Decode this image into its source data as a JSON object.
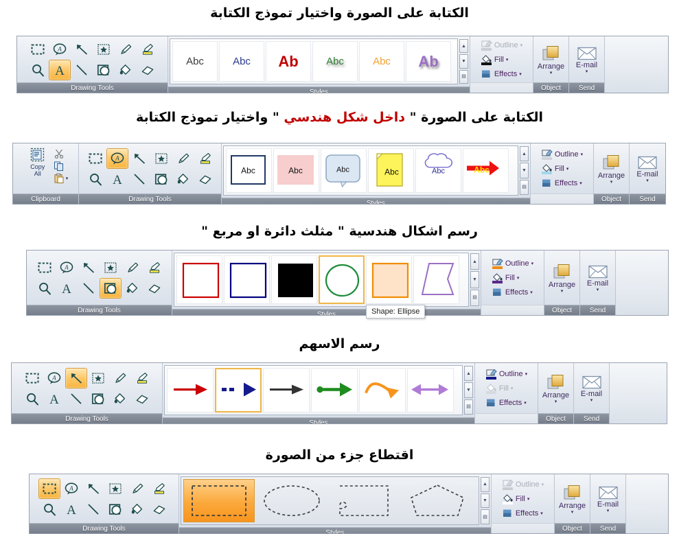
{
  "headings": [
    {
      "id": "h1",
      "text": "الكتابة على الصورة واختيار تموذج الكتابة"
    },
    {
      "id": "h2a",
      "text": "الكتابة على الصورة \" ",
      "red": "داخل شكل هندسي",
      "after": " \" واختيار تموذج الكتابة"
    },
    {
      "id": "h3",
      "text": "رسم اشكال هندسية \" مثلث دائرة او مربع \""
    },
    {
      "id": "h4",
      "text": "رسم الاسهم"
    },
    {
      "id": "h5",
      "text": "اقتطاع جزء من الصورة"
    }
  ],
  "group_labels": {
    "drawing_tools": "Drawing Tools",
    "styles": "Styles",
    "object": "Object",
    "send": "Send",
    "clipboard": "Clipboard"
  },
  "clipboard": {
    "copy_all_line1": "Copy",
    "copy_all_line2": "All",
    "cut_icon": "scissors-icon",
    "copy_icon": "copy-icon",
    "paste_icon": "paste-icon",
    "paste_caret": "▾"
  },
  "tool_names": [
    "select-rectangle-tool",
    "callout-text-tool",
    "arrow-line-tool",
    "stamp-tool",
    "pencil-tool",
    "highlighter-tool",
    "magnifier-tool",
    "text-tool",
    "line-tool",
    "shape-tool",
    "fill-bucket-tool",
    "eraser-tool"
  ],
  "panel": {
    "outline_label": "Outline",
    "fill_label": "Fill",
    "effects_label": "Effects",
    "caret": "▾",
    "arrange_label": "Arrange",
    "email_label": "E-mail",
    "arrange_caret": "▾",
    "email_caret": "▾"
  },
  "scroll": {
    "up": "▲",
    "down": "▼",
    "more": "▤"
  },
  "ribbons": [
    {
      "id": "ribbon-text-styles",
      "has_clipboard": false,
      "active_tool_index": 7,
      "gallery_kind": "text-styles",
      "items": [
        {
          "label": "Abc",
          "color": "#3b3b3b",
          "bold": false,
          "big": false,
          "shadow": false
        },
        {
          "label": "Abc",
          "color": "#2b3a8f",
          "bold": false,
          "big": false,
          "shadow": false
        },
        {
          "label": "Ab",
          "color": "#c00000",
          "bold": true,
          "big": true,
          "shadow": false
        },
        {
          "label": "Abc",
          "color": "#2e7d32",
          "bold": false,
          "big": false,
          "shadow": true
        },
        {
          "label": "Abc",
          "color": "#f0a030",
          "bold": false,
          "big": false,
          "shadow": false
        },
        {
          "label": "Ab",
          "color": "#9b6fc4",
          "bold": true,
          "big": true,
          "shadow": true
        }
      ],
      "outline_enabled": false,
      "outline_swatch": "#c9ccd2",
      "fill_enabled": true,
      "fill_swatch": "#111111",
      "effects_enabled": true,
      "tooltip": null
    },
    {
      "id": "ribbon-shape-text",
      "has_clipboard": true,
      "active_tool_index": 1,
      "gallery_kind": "shape-text",
      "items": [
        {
          "name": "rect-navy-outline",
          "label": "Abc"
        },
        {
          "name": "rect-pink-fill",
          "label": "Abc"
        },
        {
          "name": "rounded-callout",
          "label": "Abc"
        },
        {
          "name": "sticky-note",
          "label": "Abc"
        },
        {
          "name": "cloud-callout",
          "label": "Abc"
        },
        {
          "name": "red-arrow",
          "label": "Abc"
        }
      ],
      "outline_enabled": true,
      "outline_swatch": "#cfd3da",
      "fill_enabled": true,
      "fill_swatch": "#9fd8ee",
      "effects_enabled": true,
      "tooltip": null
    },
    {
      "id": "ribbon-shapes",
      "has_clipboard": false,
      "active_tool_index": 9,
      "gallery_kind": "shapes",
      "items": [
        {
          "name": "rect-red-outline",
          "stroke": "#cc0000",
          "fill": "#ffffff"
        },
        {
          "name": "rect-blue-outline",
          "stroke": "#000080",
          "fill": "#ffffff"
        },
        {
          "name": "rect-black-filled",
          "stroke": "#000000",
          "fill": "#000000"
        },
        {
          "name": "ellipse-green-outline",
          "stroke": "#1e8c3a",
          "fill": "#ffffff"
        },
        {
          "name": "rect-orange-peach",
          "stroke": "#f08c00",
          "fill": "#ffe3c9"
        },
        {
          "name": "polygon-purple-outline",
          "stroke": "#9b6fc4",
          "fill": "#ffffff"
        }
      ],
      "selected_index": 3,
      "outline_enabled": true,
      "outline_swatch": "#ef8c18",
      "fill_enabled": true,
      "fill_swatch": "#5b2a8c",
      "effects_enabled": true,
      "tooltip": "Shape: Ellipse"
    },
    {
      "id": "ribbon-arrows",
      "has_clipboard": false,
      "active_tool_index": 2,
      "gallery_kind": "arrows",
      "items": [
        {
          "name": "arrow-red-thin",
          "color": "#cc0000"
        },
        {
          "name": "arrow-navy-dashed-block",
          "color": "#151a8c"
        },
        {
          "name": "arrow-black-plain",
          "color": "#333333"
        },
        {
          "name": "arrow-green-dot-start",
          "color": "#1e8c1e"
        },
        {
          "name": "arrow-orange-curved",
          "color": "#f7941e"
        },
        {
          "name": "arrow-purple-double",
          "color": "#b07ad6"
        }
      ],
      "selected_index": 1,
      "outline_enabled": true,
      "outline_swatch": "#151a8c",
      "fill_enabled": false,
      "fill_swatch": "#d7dbe1",
      "effects_enabled": true,
      "tooltip": null
    },
    {
      "id": "ribbon-crop",
      "has_clipboard": false,
      "active_tool_index": 0,
      "gallery_kind": "crop",
      "items": [
        {
          "name": "crop-rectangle"
        },
        {
          "name": "crop-ellipse"
        },
        {
          "name": "crop-freehand"
        },
        {
          "name": "crop-polygon"
        }
      ],
      "selected_index": 0,
      "outline_enabled": false,
      "outline_swatch": "#c9ccd2",
      "fill_enabled": true,
      "fill_swatch": "#ffffff",
      "effects_enabled": true,
      "tooltip": null
    }
  ]
}
